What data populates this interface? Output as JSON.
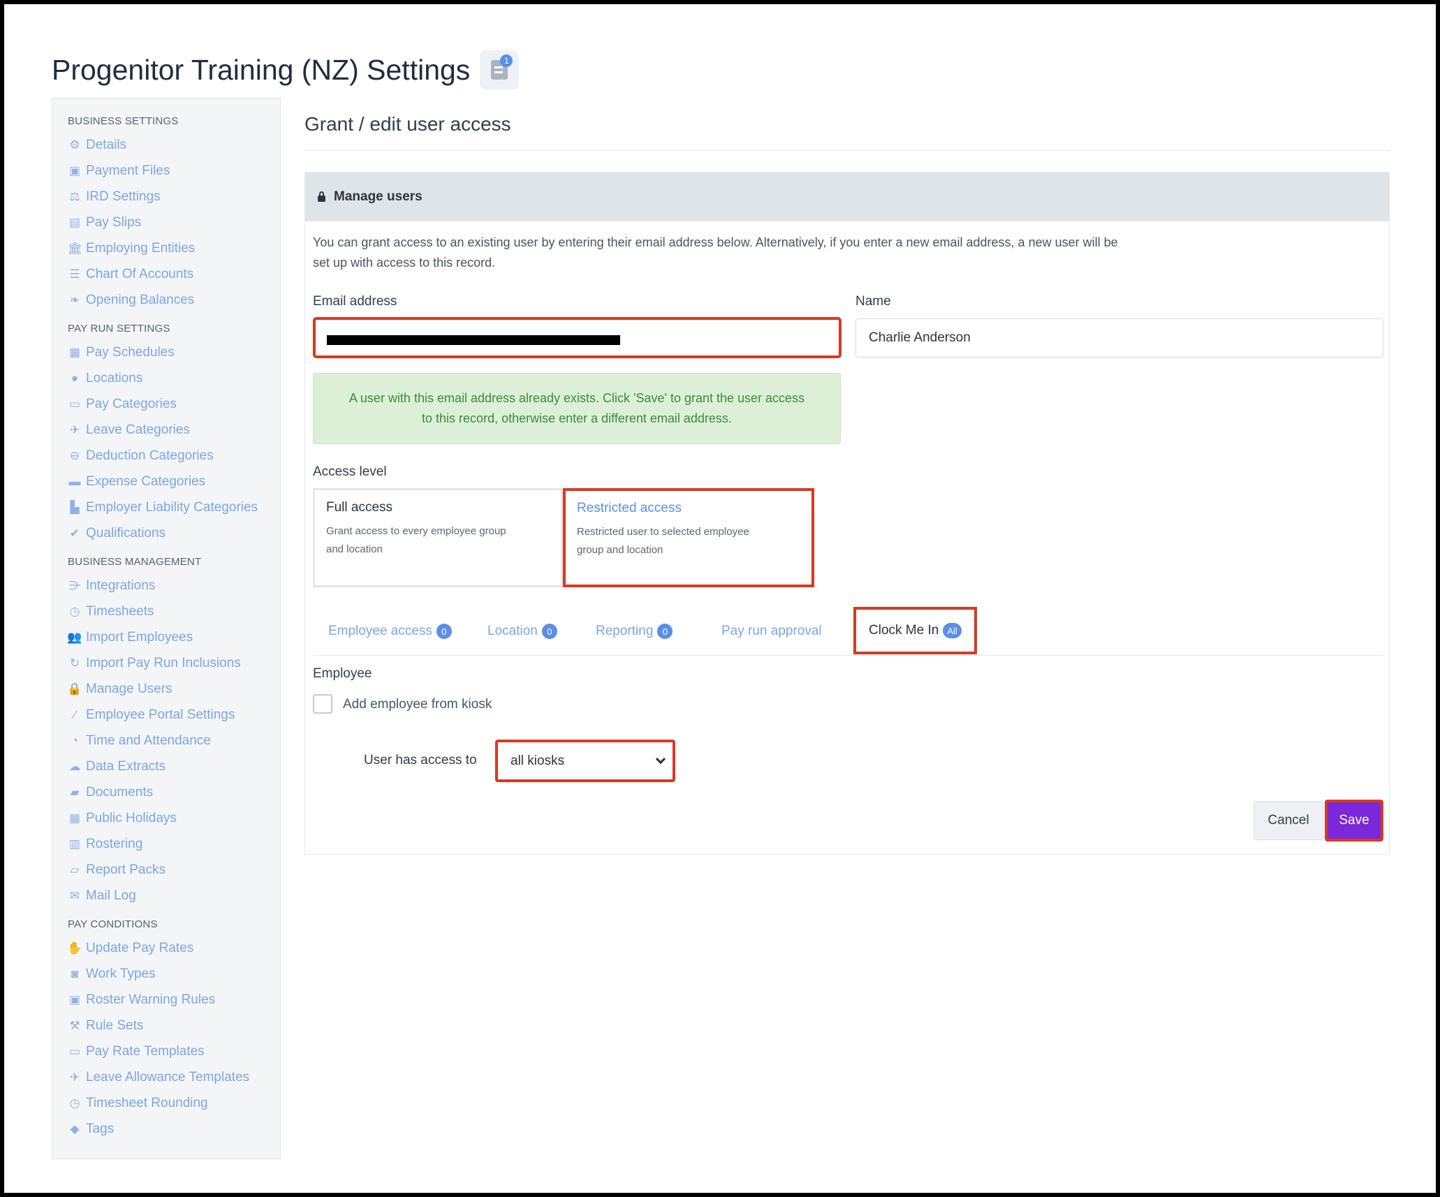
{
  "page_title": "Progenitor Training (NZ) Settings",
  "title_badge_count": "1",
  "sidebar": {
    "sections": [
      {
        "heading": "BUSINESS SETTINGS",
        "items": [
          {
            "label": "Details",
            "icon": "gear-icon",
            "glyph": "⚙"
          },
          {
            "label": "Payment Files",
            "icon": "floppy-icon",
            "glyph": "▣"
          },
          {
            "label": "IRD Settings",
            "icon": "scale-icon",
            "glyph": "⚖"
          },
          {
            "label": "Pay Slips",
            "icon": "file-icon",
            "glyph": "▤"
          },
          {
            "label": "Employing Entities",
            "icon": "bank-icon",
            "glyph": "🏛"
          },
          {
            "label": "Chart Of Accounts",
            "icon": "list-icon",
            "glyph": "☰"
          },
          {
            "label": "Opening Balances",
            "icon": "leaf-icon",
            "glyph": "❧"
          }
        ]
      },
      {
        "heading": "PAY RUN SETTINGS",
        "items": [
          {
            "label": "Pay Schedules",
            "icon": "calendar-icon",
            "glyph": "▦"
          },
          {
            "label": "Locations",
            "icon": "globe-icon",
            "glyph": "●"
          },
          {
            "label": "Pay Categories",
            "icon": "money-icon",
            "glyph": "▭"
          },
          {
            "label": "Leave Categories",
            "icon": "plane-icon",
            "glyph": "✈"
          },
          {
            "label": "Deduction Categories",
            "icon": "minus-circle-icon",
            "glyph": "⊖"
          },
          {
            "label": "Expense Categories",
            "icon": "archive-icon",
            "glyph": "▬"
          },
          {
            "label": "Employer Liability Categories",
            "icon": "bar-chart-icon",
            "glyph": "▙"
          },
          {
            "label": "Qualifications",
            "icon": "check-icon",
            "glyph": "✔"
          }
        ]
      },
      {
        "heading": "BUSINESS MANAGEMENT",
        "items": [
          {
            "label": "Integrations",
            "icon": "integrations-icon",
            "glyph": "⋺"
          },
          {
            "label": "Timesheets",
            "icon": "clock-icon",
            "glyph": "◷"
          },
          {
            "label": "Import Employees",
            "icon": "users-icon",
            "glyph": "👥"
          },
          {
            "label": "Import Pay Run Inclusions",
            "icon": "refresh-icon",
            "glyph": "↻"
          },
          {
            "label": "Manage Users",
            "icon": "lock-icon",
            "glyph": "🔒"
          },
          {
            "label": "Employee Portal Settings",
            "icon": "wand-icon",
            "glyph": "⁄"
          },
          {
            "label": "Time and Attendance",
            "icon": "stopwatch-icon",
            "glyph": "◔"
          },
          {
            "label": "Data Extracts",
            "icon": "cloud-download-icon",
            "glyph": "☁"
          },
          {
            "label": "Documents",
            "icon": "folder-icon",
            "glyph": "▰"
          },
          {
            "label": "Public Holidays",
            "icon": "calendar-icon",
            "glyph": "▦"
          },
          {
            "label": "Rostering",
            "icon": "calendar-alt-icon",
            "glyph": "▥"
          },
          {
            "label": "Report Packs",
            "icon": "folder-open-icon",
            "glyph": "▱"
          },
          {
            "label": "Mail Log",
            "icon": "envelope-icon",
            "glyph": "✉"
          }
        ]
      },
      {
        "heading": "PAY CONDITIONS",
        "items": [
          {
            "label": "Update Pay Rates",
            "icon": "hand-money-icon",
            "glyph": "✋"
          },
          {
            "label": "Work Types",
            "icon": "camera-icon",
            "glyph": "◙"
          },
          {
            "label": "Roster Warning Rules",
            "icon": "calendar-warning-icon",
            "glyph": "▣"
          },
          {
            "label": "Rule Sets",
            "icon": "gavel-icon",
            "glyph": "⚒"
          },
          {
            "label": "Pay Rate Templates",
            "icon": "money-icon",
            "glyph": "▭"
          },
          {
            "label": "Leave Allowance Templates",
            "icon": "plane-icon",
            "glyph": "✈"
          },
          {
            "label": "Timesheet Rounding",
            "icon": "clock-icon",
            "glyph": "◷"
          },
          {
            "label": "Tags",
            "icon": "tag-icon",
            "glyph": "◆"
          }
        ]
      }
    ]
  },
  "main": {
    "section_title": "Grant / edit user access",
    "panel_title": "Manage users",
    "intro_line1": "You can grant access to an existing user by entering their email address below. Alternatively, if you enter a new email address, a new user will be",
    "intro_line2": "set up with access to this record.",
    "email_label": "Email address",
    "name_label": "Name",
    "name_value": "Charlie Anderson",
    "alert_line1": "A user with this email address already exists. Click 'Save' to grant the user access",
    "alert_line2": "to this record, otherwise enter a different email address.",
    "access_level_label": "Access level",
    "full_access_title": "Full access",
    "full_access_desc1": "Grant access to every employee group",
    "full_access_desc2": "and location",
    "restricted_title": "Restricted access",
    "restricted_desc1": "Restricted user to selected employee",
    "restricted_desc2": "group and location",
    "tabs": [
      {
        "label": "Employee access",
        "badge": "0"
      },
      {
        "label": "Location",
        "badge": "0"
      },
      {
        "label": "Reporting",
        "badge": "0"
      },
      {
        "label": "Pay run approval",
        "badge": ""
      },
      {
        "label": "Clock Me In",
        "badge": "All"
      }
    ],
    "employee_heading": "Employee",
    "add_employee_label": "Add employee from kiosk",
    "kiosk_access_label": "User has access to",
    "kiosk_selected": "all kiosks",
    "cancel_label": "Cancel",
    "save_label": "Save"
  }
}
